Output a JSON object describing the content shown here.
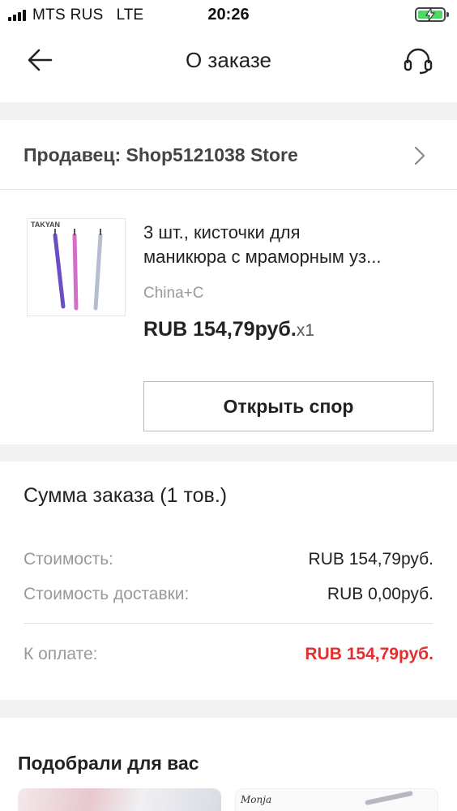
{
  "status_bar": {
    "carrier": "MTS RUS",
    "network": "LTE",
    "time": "20:26",
    "battery_color": "#4cd964"
  },
  "header": {
    "title": "О заказе",
    "back_icon": "arrow-left-icon",
    "support_icon": "headset-icon"
  },
  "seller": {
    "label": "Продавец: Shop5121038 Store",
    "chevron_icon": "chevron-right-icon"
  },
  "product": {
    "image_brand": "TAKYAN",
    "title_line1": "3 шт., кисточки для",
    "title_line2": "маникюра с мраморным уз...",
    "variant": "China+C",
    "price": "RUB 154,79руб.",
    "quantity": "x1",
    "dispute_label": "Открыть спор"
  },
  "summary": {
    "title": "Сумма заказа (1 тов.)",
    "cost_label": "Стоимость:",
    "cost_value": "RUB 154,79руб.",
    "shipping_label": "Стоимость доставки:",
    "shipping_value": "RUB 0,00руб.",
    "total_label": "К оплате:",
    "total_value": "RUB 154,79руб.",
    "total_color": "#e62e2e"
  },
  "recommendations": {
    "title": "Подобрали для вас",
    "item2_brand": "Monja"
  }
}
